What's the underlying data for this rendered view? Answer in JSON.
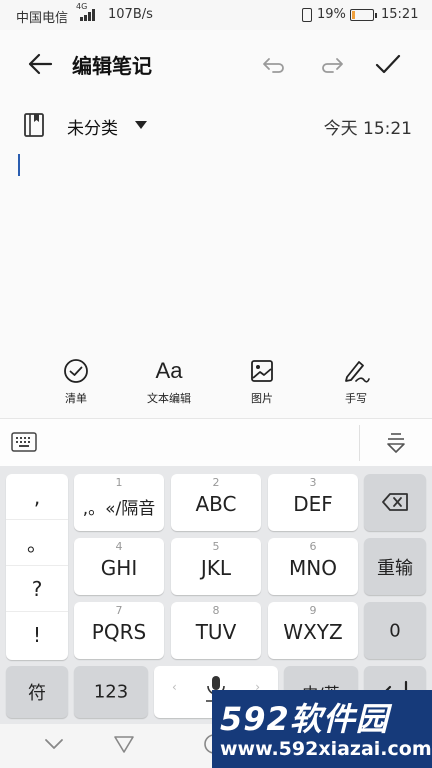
{
  "status_bar": {
    "carrier": "中国电信",
    "network_type": "4G",
    "speed": "107B/s",
    "battery_percent": "19%",
    "battery_level": 0.19,
    "time": "15:21"
  },
  "title_bar": {
    "title": "编辑笔记",
    "back_icon": "arrow-left-icon",
    "undo_icon": "undo-icon",
    "redo_icon": "redo-icon",
    "confirm_icon": "check-icon"
  },
  "note": {
    "category": "未分类",
    "timestamp": "今天 15:21"
  },
  "toolbar": {
    "items": [
      {
        "label": "清单",
        "icon": "checklist-icon"
      },
      {
        "label": "文本编辑",
        "icon": "text-format-icon"
      },
      {
        "label": "图片",
        "icon": "image-icon"
      },
      {
        "label": "手写",
        "icon": "handwriting-icon"
      }
    ]
  },
  "keyboard": {
    "punctuation": [
      ",",
      "。",
      "?",
      "!"
    ],
    "keys": [
      {
        "num": "1",
        "label": ",。«/隔音"
      },
      {
        "num": "2",
        "label": "ABC"
      },
      {
        "num": "3",
        "label": "DEF"
      },
      {
        "num": "4",
        "label": "GHI"
      },
      {
        "num": "5",
        "label": "JKL"
      },
      {
        "num": "6",
        "label": "MNO"
      },
      {
        "num": "7",
        "label": "PQRS"
      },
      {
        "num": "8",
        "label": "TUV"
      },
      {
        "num": "9",
        "label": "WXYZ"
      }
    ],
    "reenter_label": "重输",
    "zero_label": "0",
    "symbol_label": "符",
    "numbers_label": "123",
    "lang_label": "中/英"
  },
  "watermark": {
    "logo_text": "592软件园",
    "url": "www.592xiazai.com"
  },
  "colors": {
    "accent_cursor": "#2a5db0",
    "battery_low": "#f0a03c",
    "watermark_bg": "#163a7a"
  }
}
